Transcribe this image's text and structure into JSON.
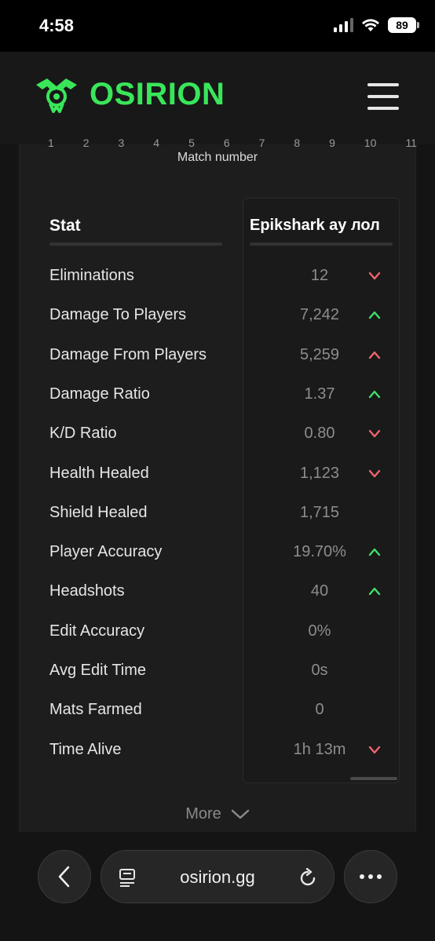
{
  "status": {
    "time": "4:58",
    "battery": "89"
  },
  "header": {
    "brand": "OSIRION"
  },
  "chart": {
    "xlabel": "Match number",
    "ticks": [
      "1",
      "2",
      "3",
      "4",
      "5",
      "6",
      "7",
      "8",
      "9",
      "10",
      "11"
    ]
  },
  "table": {
    "stat_header": "Stat",
    "player_header": "Epikshark ау лол",
    "rows": [
      {
        "name": "Eliminations",
        "value": "12",
        "trend": "down"
      },
      {
        "name": "Damage To Players",
        "value": "7,242",
        "trend": "up"
      },
      {
        "name": "Damage From Players",
        "value": "5,259",
        "trend": "up-bad"
      },
      {
        "name": "Damage Ratio",
        "value": "1.37",
        "trend": "up"
      },
      {
        "name": "K/D Ratio",
        "value": "0.80",
        "trend": "down"
      },
      {
        "name": "Health Healed",
        "value": "1,123",
        "trend": "down"
      },
      {
        "name": "Shield Healed",
        "value": "1,715",
        "trend": "none"
      },
      {
        "name": "Player Accuracy",
        "value": "19.70%",
        "trend": "up"
      },
      {
        "name": "Headshots",
        "value": "40",
        "trend": "up"
      },
      {
        "name": "Edit Accuracy",
        "value": "0%",
        "trend": "none"
      },
      {
        "name": "Avg Edit Time",
        "value": "0s",
        "trend": "none"
      },
      {
        "name": "Mats Farmed",
        "value": "0",
        "trend": "none"
      },
      {
        "name": "Time Alive",
        "value": "1h 13m",
        "trend": "down"
      }
    ],
    "more_label": "More"
  },
  "browser": {
    "url": "osirion.gg"
  },
  "colors": {
    "brand": "#39e65a",
    "up": "#3ee06a",
    "down": "#f0646e"
  },
  "icons": {
    "back": "chevron-left-icon",
    "tabs": "tabs-icon",
    "reload": "reload-icon",
    "more": "ellipsis-icon",
    "menu": "hamburger-icon",
    "logo": "osirion-logo-icon"
  }
}
